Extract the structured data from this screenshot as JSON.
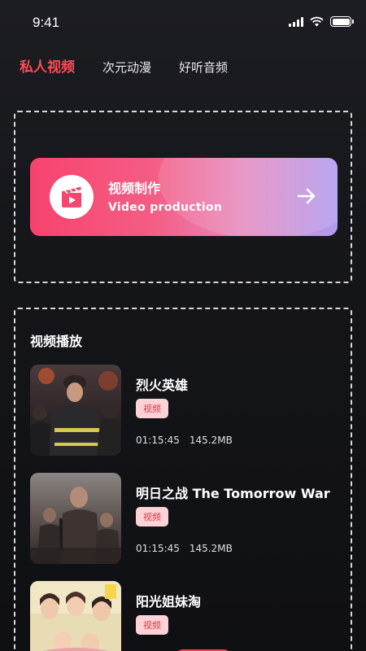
{
  "status_bar": {
    "time": "9:41"
  },
  "tabs": [
    {
      "label": "私人视频",
      "active": true
    },
    {
      "label": "次元动漫",
      "active": false
    },
    {
      "label": "好听音频",
      "active": false
    }
  ],
  "production": {
    "title": "视频制作",
    "subtitle": "Video production",
    "icon": "clapperboard-play-icon",
    "action_icon": "arrow-right-icon"
  },
  "playback": {
    "title": "视频播放",
    "videos": [
      {
        "title": "烈火英雄",
        "badge": "视频",
        "duration": "01:15:45",
        "size": "145.2MB"
      },
      {
        "title": "明日之战 The Tomorrow War",
        "badge": "视频",
        "duration": "01:15:45",
        "size": "145.2MB"
      },
      {
        "title": "阳光姐妹淘",
        "badge": "视频",
        "duration": "",
        "size": ""
      }
    ]
  },
  "colors": {
    "accent": "#ff4a55",
    "badge_bg": "#fbd3d6",
    "badge_text": "#e2323f",
    "card_gradient_start": "#f7436d",
    "card_gradient_end": "#b09bf0"
  }
}
